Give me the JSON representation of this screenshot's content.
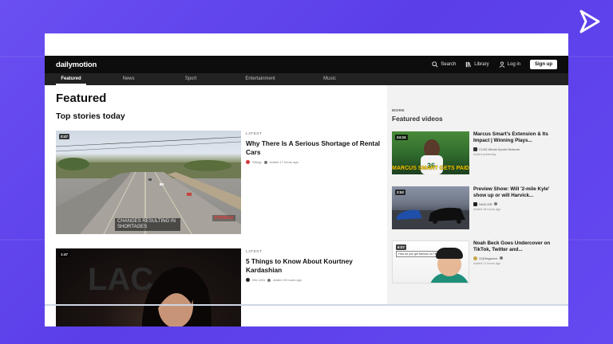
{
  "header": {
    "brand": "dailymotion",
    "search_label": "Search",
    "library_label": "Library",
    "login_label": "Log in",
    "signup_label": "Sign up"
  },
  "nav": {
    "tabs": [
      {
        "label": "Featured",
        "active": true
      },
      {
        "label": "News",
        "active": false
      },
      {
        "label": "Sport",
        "active": false
      },
      {
        "label": "Entertainment",
        "active": false
      },
      {
        "label": "Music",
        "active": false
      }
    ]
  },
  "main": {
    "title": "Featured",
    "section_title": "Top stories today",
    "stories": [
      {
        "duration": "0:47",
        "kicker": "LATEST",
        "title": "Why There Is A Serious Shortage of Rental Cars",
        "channel": "Stringr",
        "added": "Added 17 hours ago",
        "caption": "CHANGES RESULTING IN SHORTAGES",
        "watermark": "STRINGR"
      },
      {
        "duration": "1:47",
        "kicker": "LATEST",
        "title": "5 Things to Know About Kourtney Kardashian",
        "channel": "Elle USA",
        "added": "Added 20 hours ago"
      }
    ]
  },
  "sidebar": {
    "more_label": "MORE",
    "title": "Featured videos",
    "items": [
      {
        "duration": "24:24",
        "title": "Marcus Smart's Extension & Its Impact | Winning Plays...",
        "channel": "CLNS Media Sports Network",
        "added": "Added yesterday",
        "thumb_text": "MARCUS SMART GETS PAID"
      },
      {
        "duration": "2:52",
        "title": "Preview Show: Will '2-mile Kyle' show up or will Harvick...",
        "channel": "NASCAR",
        "added": "Added 18 hours ago"
      },
      {
        "duration": "6:07",
        "title": "Noah Beck Goes Undercover on TikTok, Twitter and...",
        "channel": "GQMagazine",
        "added": "Added 17 hours ago",
        "thumb_text": "How do you get famous on TikTok?"
      }
    ]
  },
  "colors": {
    "background": "#5b3ee8",
    "topbar": "#0d0d0d",
    "navbar": "#222222",
    "sidebar": "#f2f2f2"
  }
}
